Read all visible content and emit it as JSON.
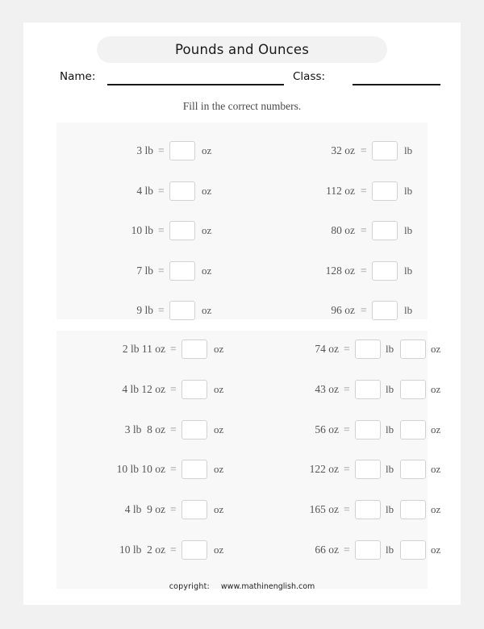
{
  "worksheet": {
    "title": "Pounds and Ounces",
    "name_label": "Name:",
    "class_label": "Class:",
    "instruction": "Fill in the correct numbers.",
    "footer": {
      "copyright_label": "copyright:",
      "site": "www.mathinenglish.com"
    },
    "colors": {
      "page_background": "#f1f1f1",
      "sheet": "#ffffff",
      "panel": "#f8f8f8",
      "title_pill": "#f2f2f2",
      "box_border": "#d2d2d2",
      "text": "#555555",
      "rule": "#1a1a1a"
    },
    "equals_sign": "=",
    "units": {
      "pound": "lb",
      "ounce": "oz"
    }
  },
  "sections": [
    {
      "id": "section-1",
      "rows": [
        {
          "left": {
            "question": "3 lb",
            "unit": "oz"
          },
          "right": {
            "question": "32 oz",
            "unit": "lb"
          }
        },
        {
          "left": {
            "question": "4 lb",
            "unit": "oz"
          },
          "right": {
            "question": "112 oz",
            "unit": "lb"
          }
        },
        {
          "left": {
            "question": "10 lb",
            "unit": "oz"
          },
          "right": {
            "question": "80 oz",
            "unit": "lb"
          }
        },
        {
          "left": {
            "question": "7 lb",
            "unit": "oz"
          },
          "right": {
            "question": "128 oz",
            "unit": "lb"
          }
        },
        {
          "left": {
            "question": "9 lb",
            "unit": "oz"
          },
          "right": {
            "question": "96 oz",
            "unit": "lb"
          }
        }
      ]
    },
    {
      "id": "section-2",
      "rows": [
        {
          "left": {
            "question": "2 lb 11 oz",
            "unit": "oz"
          },
          "right": {
            "question": "74 oz",
            "unit_1": "lb",
            "unit_2": "oz"
          }
        },
        {
          "left": {
            "question": "4 lb 12 oz",
            "unit": "oz"
          },
          "right": {
            "question": "43 oz",
            "unit_1": "lb",
            "unit_2": "oz"
          }
        },
        {
          "left": {
            "question": "3 lb  8 oz",
            "unit": "oz"
          },
          "right": {
            "question": "56 oz",
            "unit_1": "lb",
            "unit_2": "oz"
          }
        },
        {
          "left": {
            "question": "10 lb 10 oz",
            "unit": "oz"
          },
          "right": {
            "question": "122 oz",
            "unit_1": "lb",
            "unit_2": "oz"
          }
        },
        {
          "left": {
            "question": "4 lb  9 oz",
            "unit": "oz"
          },
          "right": {
            "question": "165 oz",
            "unit_1": "lb",
            "unit_2": "oz"
          }
        },
        {
          "left": {
            "question": "10 lb  2 oz",
            "unit": "oz"
          },
          "right": {
            "question": "66 oz",
            "unit_1": "lb",
            "unit_2": "oz"
          }
        }
      ]
    }
  ]
}
